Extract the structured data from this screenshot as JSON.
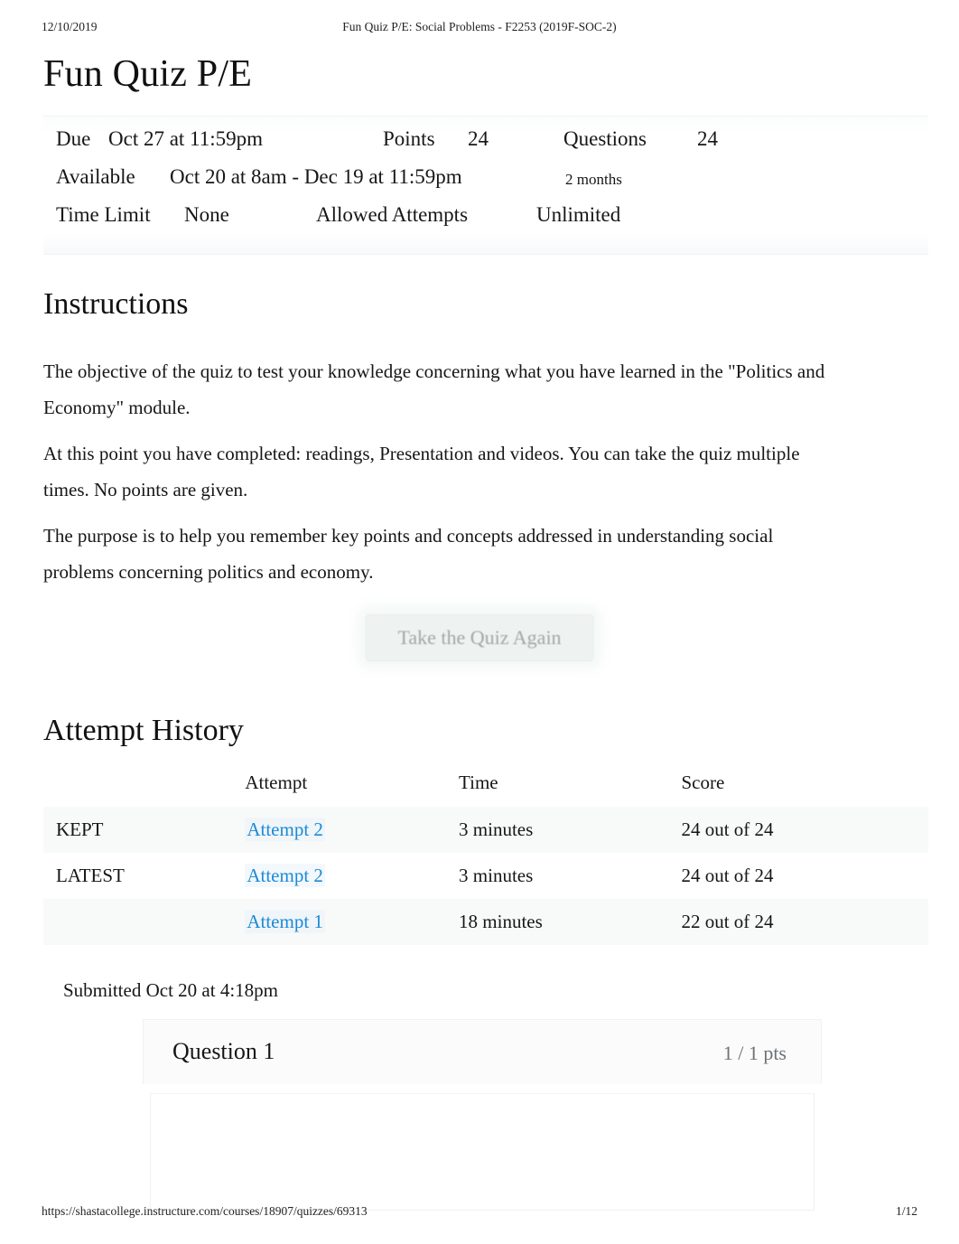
{
  "print": {
    "header_date": "12/10/2019",
    "header_title": "Fun Quiz P/E: Social Problems - F2253 (2019F-SOC-2)",
    "footer_url": "https://shastacollege.instructure.com/courses/18907/quizzes/69313",
    "footer_page": "1/12"
  },
  "quiz": {
    "title": "Fun Quiz P/E",
    "meta": {
      "due_label": "Due",
      "due_value": "Oct 27 at 11:59pm",
      "points_label": "Points",
      "points_value": "24",
      "questions_label": "Questions",
      "questions_value": "24",
      "available_label": "Available",
      "available_value": "Oct 20 at 8am - Dec 19 at 11:59pm",
      "available_duration": "2 months",
      "time_limit_label": "Time Limit",
      "time_limit_value": "None",
      "allowed_attempts_label": "Allowed Attempts",
      "allowed_attempts_value": "Unlimited"
    }
  },
  "instructions": {
    "heading": "Instructions",
    "paragraphs": [
      "The objective of the quiz to test your knowledge concerning what you have learned in the \"Politics and Economy\" module.",
      "At this point you have completed: readings, Presentation and videos. You can take the quiz multiple times. No points are given.",
      "The purpose is to help you remember key points and concepts addressed in understanding social problems concerning politics and economy."
    ]
  },
  "actions": {
    "take_quiz_again": "Take the Quiz Again"
  },
  "attempt_history": {
    "heading": "Attempt History",
    "columns": [
      "",
      "Attempt",
      "Time",
      "Score"
    ],
    "rows": [
      {
        "flag": "KEPT",
        "attempt": "Attempt 2",
        "time": "3 minutes",
        "score": "24 out of 24"
      },
      {
        "flag": "LATEST",
        "attempt": "Attempt 2",
        "time": "3 minutes",
        "score": "24 out of 24"
      },
      {
        "flag": "",
        "attempt": "Attempt 1",
        "time": "18 minutes",
        "score": "22 out of 24"
      }
    ]
  },
  "submission": {
    "submitted_text": "Submitted Oct 20 at 4:18pm"
  },
  "question": {
    "label": "Question 1",
    "points": "1 / 1 pts"
  },
  "colors": {
    "link_blue": "#1b8ad8",
    "text": "#161616",
    "muted": "#6f7376",
    "row_stripe": "#f8f9f9",
    "button_bg": "#edf2f1",
    "button_text": "#9aa0a0"
  }
}
